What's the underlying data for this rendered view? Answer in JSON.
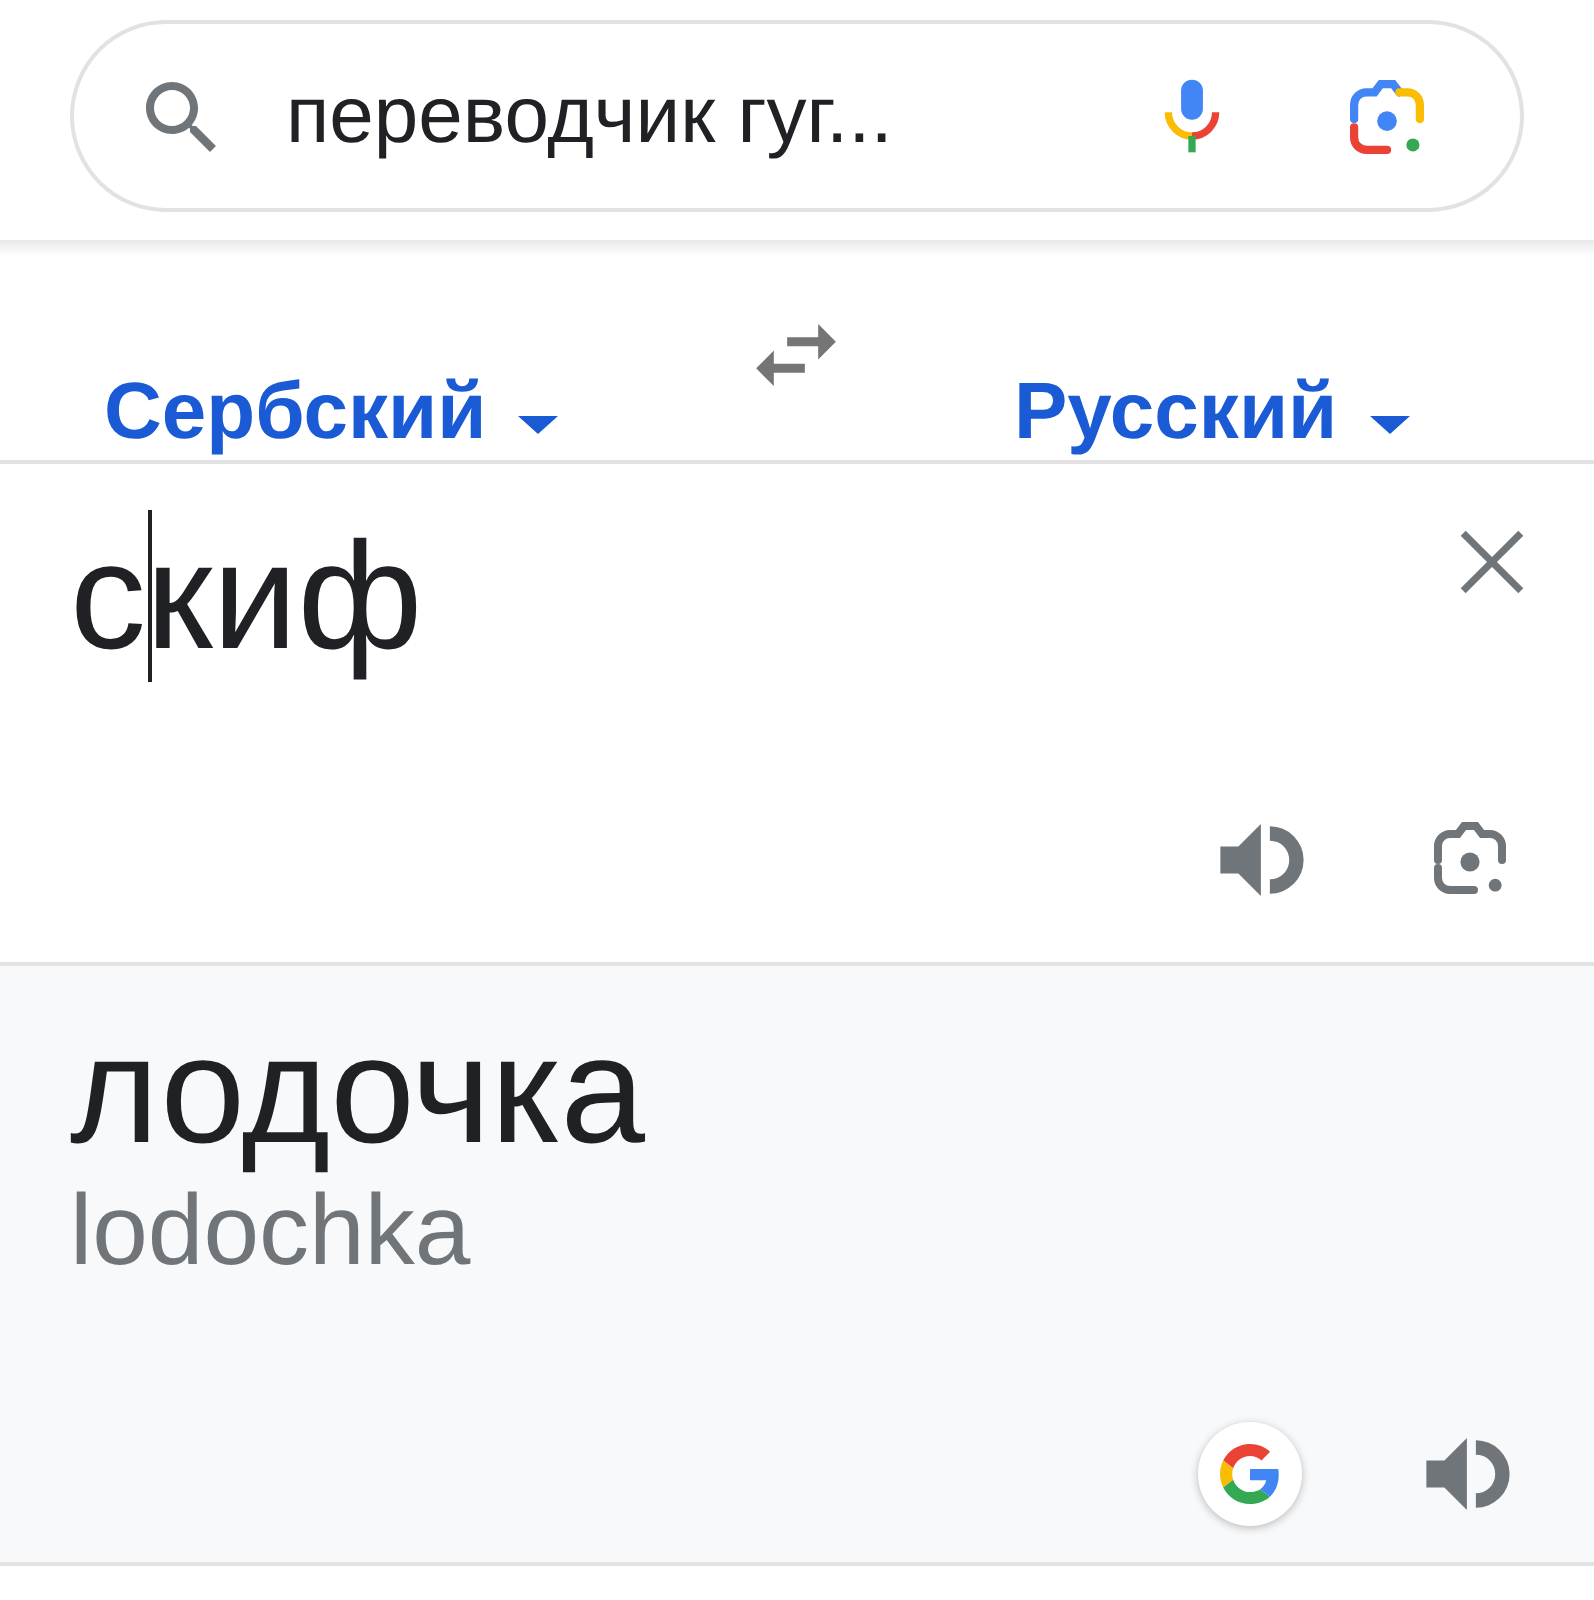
{
  "search": {
    "value": "переводчик гуг..."
  },
  "languages": {
    "source": {
      "label": "Сербский"
    },
    "target": {
      "label": "Русский"
    }
  },
  "input": {
    "value_before_caret": "с",
    "value_after_caret": "киф"
  },
  "output": {
    "translation": "лодочка",
    "transliteration": "lodochka"
  }
}
